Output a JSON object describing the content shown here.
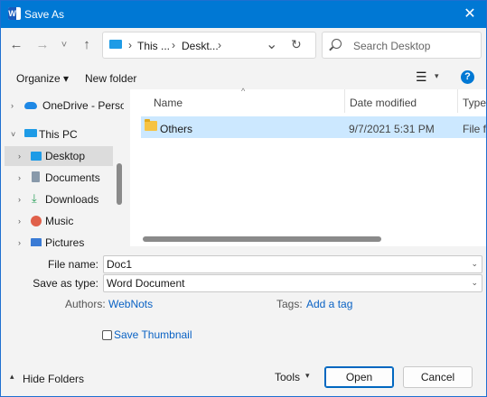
{
  "titlebar": {
    "title": "Save As",
    "app_icon": "W",
    "close_glyph": "✕"
  },
  "nav": {
    "back_glyph": "←",
    "forward_glyph": "→",
    "recent_glyph": "˅",
    "up_glyph": "↑",
    "breadcrumbs": [
      "This ...",
      "Deskt..."
    ],
    "breadcrumb_sep": "›",
    "address_dropdown_glyph": "⌄",
    "refresh_glyph": "↻",
    "search_placeholder": "Search Desktop"
  },
  "toolbar": {
    "organize_label": "Organize ▾",
    "new_folder_label": "New folder",
    "view_glyph": "☰",
    "view_dropdown_glyph": "▾",
    "help_glyph": "?"
  },
  "tree": [
    {
      "label": "OneDrive - Persor",
      "chevron": "›",
      "icon": "cloud-icon",
      "color": "#1e88e5"
    },
    {
      "label": "This PC",
      "chevron": "˅",
      "icon": "pc-icon",
      "color": "#1e9be6"
    },
    {
      "label": "Desktop",
      "chevron": "›",
      "icon": "desktop-icon",
      "color": "#1e9be6",
      "selected": true
    },
    {
      "label": "Documents",
      "chevron": "›",
      "icon": "documents-icon",
      "color": "#8899aa"
    },
    {
      "label": "Downloads",
      "chevron": "›",
      "icon": "downloads-icon",
      "color": "#2aa05a"
    },
    {
      "label": "Music",
      "chevron": "›",
      "icon": "music-icon",
      "color": "#e0604a"
    },
    {
      "label": "Pictures",
      "chevron": "›",
      "icon": "pictures-icon",
      "color": "#3a7bd5"
    }
  ],
  "file_list": {
    "sort_glyph": "^",
    "columns": [
      "Name",
      "Date modified",
      "Type"
    ],
    "rows": [
      {
        "name": "Others",
        "date": "9/7/2021 5:31 PM",
        "type": "File fc"
      }
    ]
  },
  "form": {
    "file_name_label": "File name:",
    "file_name_value": "Doc1",
    "save_type_label": "Save as type:",
    "save_type_value": "Word Document",
    "combo_arrow": "⌄",
    "authors_label": "Authors:",
    "authors_value": "WebNots",
    "tags_label": "Tags:",
    "tags_value": "Add a tag",
    "thumbnail_label": "Save Thumbnail",
    "thumbnail_checked": false
  },
  "footer": {
    "hide_folders_label": "Hide Folders",
    "hide_glyph": "▴",
    "tools_label": "Tools",
    "tools_glyph": "▾",
    "open_label": "Open",
    "cancel_label": "Cancel"
  },
  "colors": {
    "accent": "#0078d4",
    "selection": "#cce8ff",
    "link": "#0a62c4"
  }
}
